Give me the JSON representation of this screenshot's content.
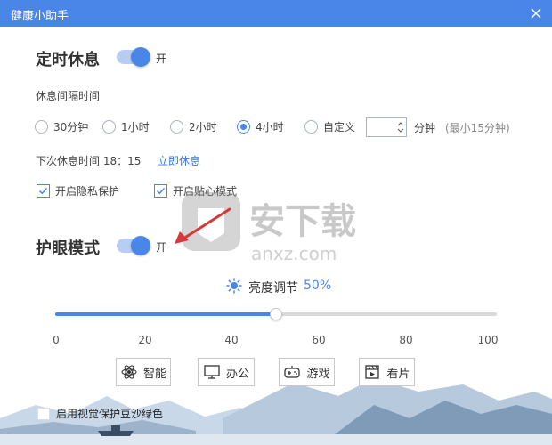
{
  "app": {
    "title": "健康小助手"
  },
  "rest": {
    "title": "定时休息",
    "toggle_text": "开",
    "interval_label": "休息间隔时间",
    "options": [
      {
        "label": "30分钟",
        "checked": false
      },
      {
        "label": "1小时",
        "checked": false
      },
      {
        "label": "2小时",
        "checked": false
      },
      {
        "label": "4小时",
        "checked": true
      },
      {
        "label": "自定义",
        "checked": false
      }
    ],
    "custom_value": "",
    "unit": "分钟",
    "hint": "(最小15分钟)",
    "next_rest_label": "下次休息时间 18：15",
    "rest_now": "立即休息",
    "checks": [
      {
        "label": "开启隐私保护",
        "checked": true
      },
      {
        "label": "开启贴心模式",
        "checked": true
      }
    ]
  },
  "eye": {
    "title": "护眼模式",
    "toggle_text": "开",
    "brightness_label": "亮度调节",
    "brightness_value": "50%",
    "brightness_level": 50,
    "ticks": [
      "0",
      "20",
      "40",
      "60",
      "80",
      "100"
    ],
    "modes": [
      {
        "label": "智能",
        "icon": "atom-icon"
      },
      {
        "label": "办公",
        "icon": "monitor-icon"
      },
      {
        "label": "游戏",
        "icon": "gamepad-icon"
      },
      {
        "label": "看片",
        "icon": "film-icon"
      }
    ],
    "green_bg_label": "启用视觉保护豆沙绿色"
  },
  "watermark": {
    "brand": "安下载",
    "site": "anxz.com"
  },
  "colors": {
    "accent": "#4a86e8",
    "title_bar": "#4a86e8",
    "annotation_arrow": "#d9383a"
  }
}
